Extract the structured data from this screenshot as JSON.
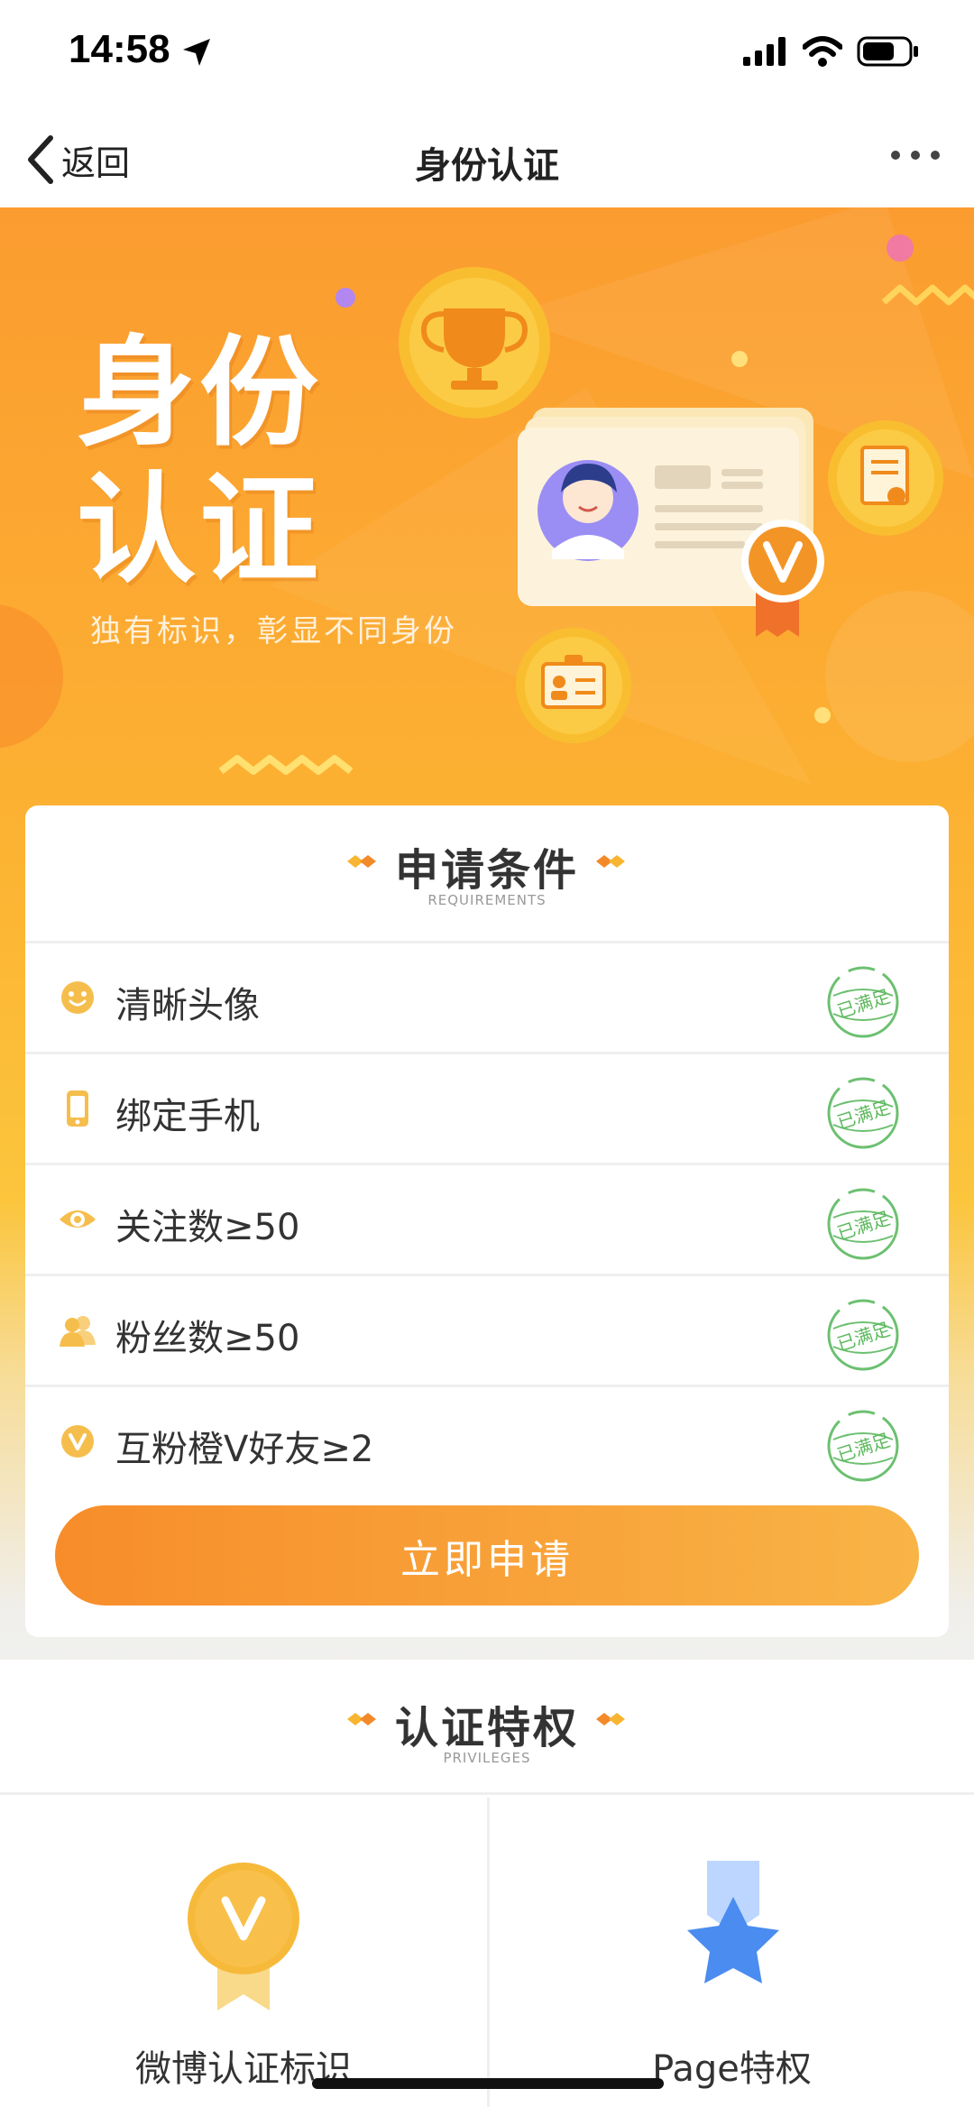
{
  "status_bar": {
    "time": "14:58"
  },
  "nav": {
    "back_label": "返回",
    "title": "身份认证"
  },
  "hero": {
    "title_line1": "身份",
    "title_line2": "认证",
    "slogan": "独有标识，彰显不同身份"
  },
  "requirements": {
    "title": "申请条件",
    "subtitle": "REQUIREMENTS",
    "items": [
      {
        "label": "清晰头像",
        "icon": "smile-face-icon",
        "status": "已满足"
      },
      {
        "label": "绑定手机",
        "icon": "phone-icon",
        "status": "已满足"
      },
      {
        "label": "关注数≥50",
        "icon": "eye-icon",
        "status": "已满足"
      },
      {
        "label": "粉丝数≥50",
        "icon": "users-icon",
        "status": "已满足"
      },
      {
        "label": "互粉橙V好友≥2",
        "icon": "v-badge-icon",
        "status": "已满足"
      }
    ],
    "apply_label": "立即申请"
  },
  "privileges": {
    "title": "认证特权",
    "subtitle": "PRIVILEGES",
    "items": [
      {
        "label": "微博认证标识",
        "icon": "v-medal-icon"
      },
      {
        "label": "Page特权",
        "icon": "star-ribbon-icon"
      }
    ]
  },
  "colors": {
    "accent_orange": "#f9a23a",
    "stamp_green": "#5cb85c",
    "icon_yellow": "#f5be4c"
  }
}
